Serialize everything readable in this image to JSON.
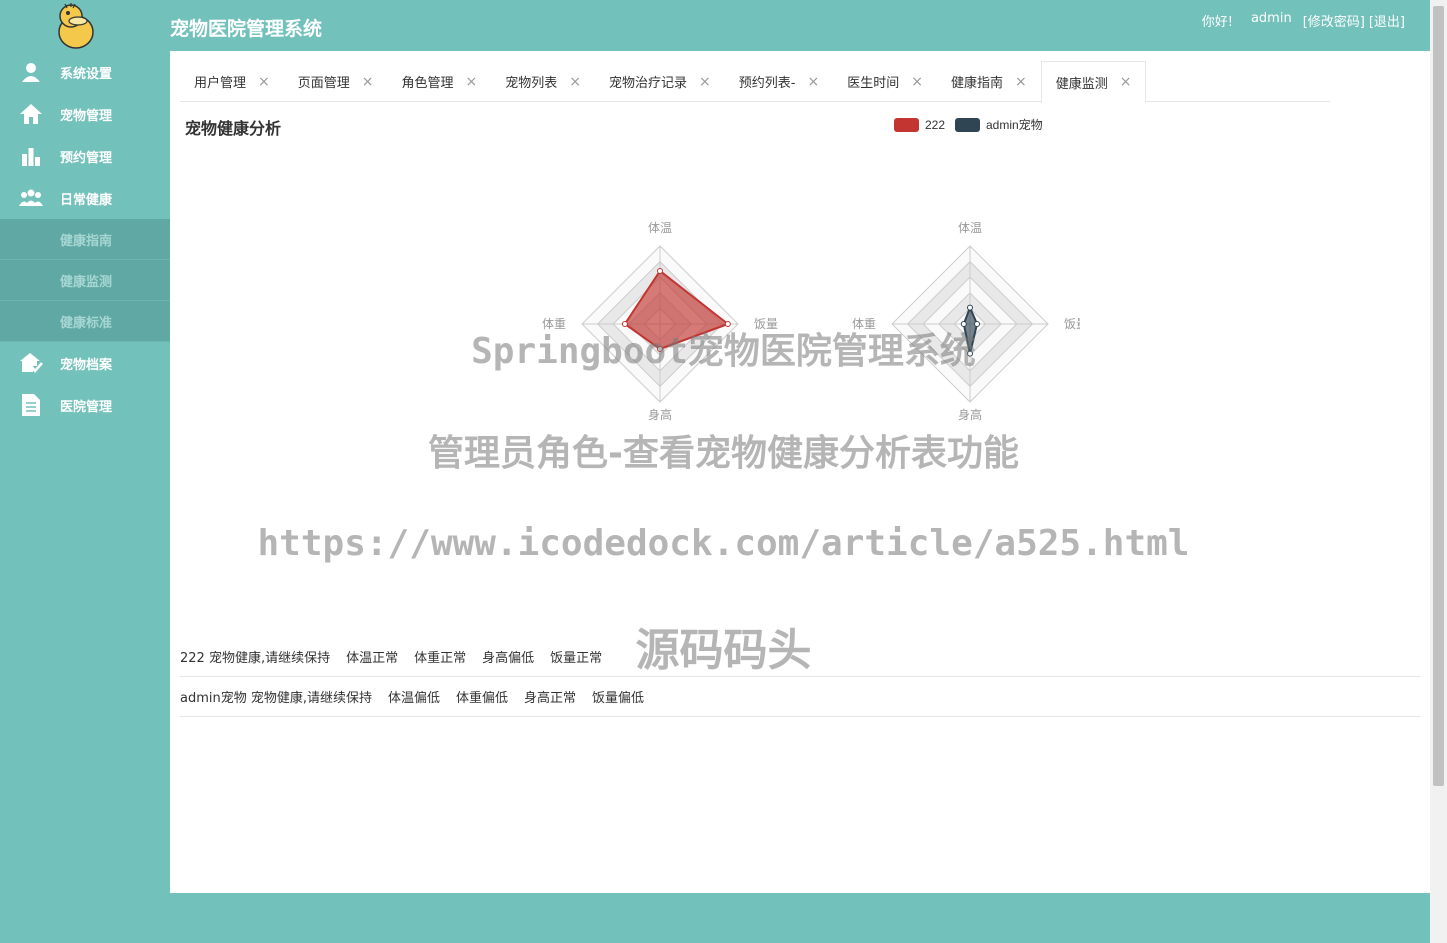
{
  "app": {
    "title": "宠物医院管理系统"
  },
  "header": {
    "greeting": "你好!",
    "user": "admin",
    "change_password": "[修改密码]",
    "logout": "[退出]"
  },
  "sidebar": {
    "items": [
      {
        "label": "系统设置",
        "icon": "user-icon"
      },
      {
        "label": "宠物管理",
        "icon": "home-icon"
      },
      {
        "label": "预约管理",
        "icon": "bar-chart-icon"
      },
      {
        "label": "日常健康",
        "icon": "group-icon"
      },
      {
        "label": "宠物档案",
        "icon": "pet-house-icon"
      },
      {
        "label": "医院管理",
        "icon": "document-icon"
      }
    ],
    "submenu": [
      {
        "label": "健康指南"
      },
      {
        "label": "健康监测"
      },
      {
        "label": "健康标准"
      }
    ]
  },
  "tabs": [
    {
      "label": "用户管理"
    },
    {
      "label": "页面管理"
    },
    {
      "label": "角色管理"
    },
    {
      "label": "宠物列表"
    },
    {
      "label": "宠物治疗记录"
    },
    {
      "label": "预约列表-"
    },
    {
      "label": "医生时间"
    },
    {
      "label": "健康指南"
    },
    {
      "label": "健康监测",
      "active": true
    }
  ],
  "section": {
    "title": "宠物健康分析"
  },
  "chart_data": {
    "type": "radar",
    "indicators": [
      "体温",
      "饭量",
      "身高",
      "体重"
    ],
    "series": [
      {
        "name": "222",
        "values": [
          0.68,
          0.87,
          0.32,
          0.45
        ],
        "color": "#c23531"
      },
      {
        "name": "admin宠物",
        "values": [
          0.21,
          0.09,
          0.38,
          0.08
        ],
        "color": "#2f4554"
      }
    ]
  },
  "rows": [
    {
      "cells": [
        "222 宠物健康,请继续保持",
        "体温正常",
        "体重正常",
        "身高偏低",
        "饭量正常"
      ]
    },
    {
      "cells": [
        "admin宠物 宠物健康,请继续保持",
        "体温偏低",
        "体重偏低",
        "身高正常",
        "饭量偏低"
      ]
    }
  ],
  "watermark": {
    "line1": "Springboot宠物医院管理系统",
    "line2": "管理员角色-查看宠物健康分析表功能",
    "line3": "https://www.icodedock.com/article/a525.html",
    "line4": "源码码头"
  }
}
